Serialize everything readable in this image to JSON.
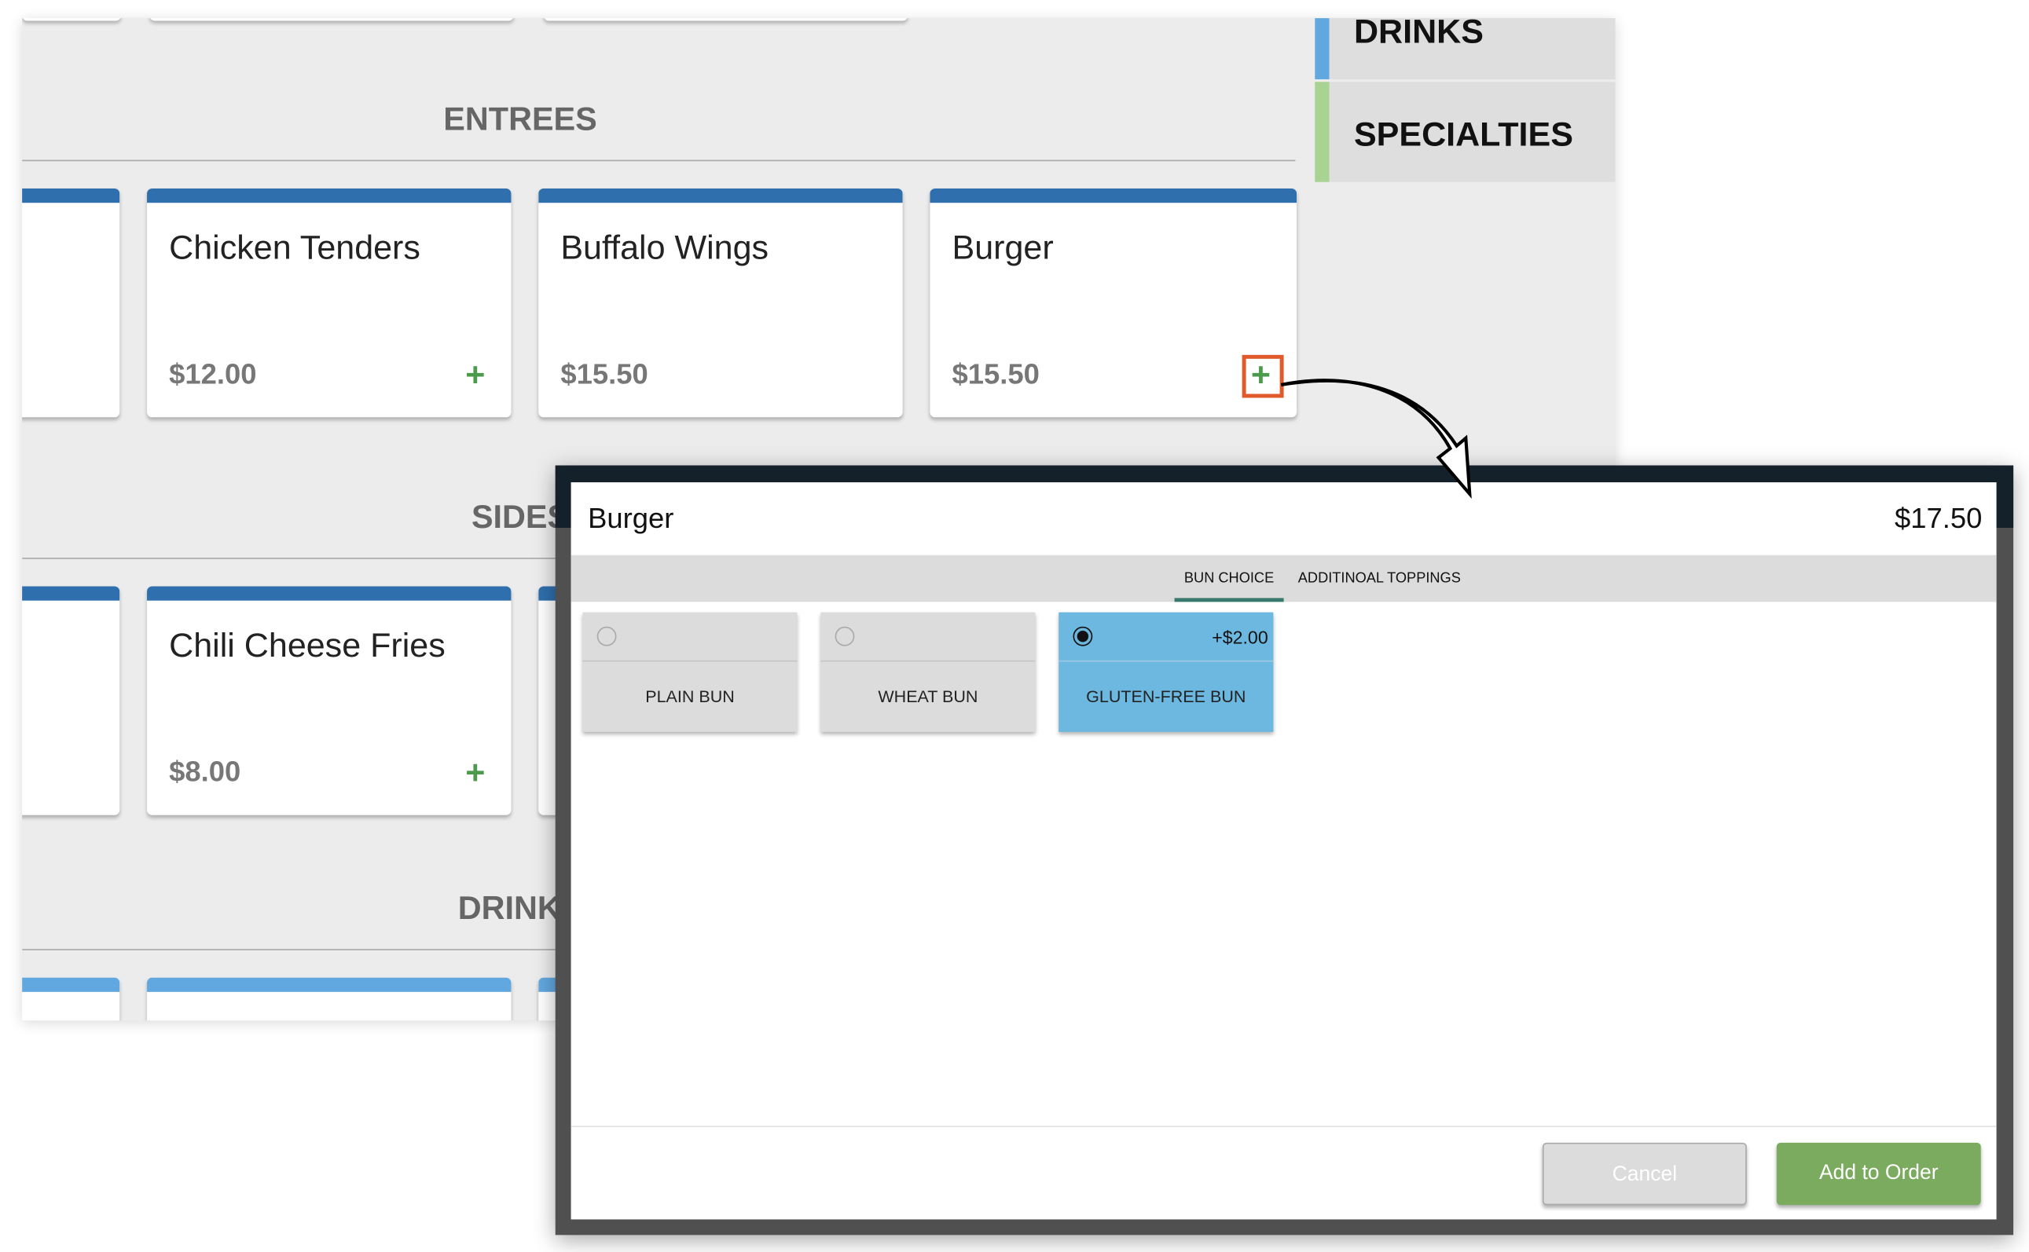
{
  "sidebar": {
    "items": [
      {
        "label": "DRINKS",
        "color": "#62a8e0"
      },
      {
        "label": "SPECIALTIES",
        "color": "#a8d392"
      }
    ]
  },
  "sections": [
    {
      "title": "ENTREES",
      "items": [
        {
          "name": "Chicken Tenders",
          "price": "$12.00"
        },
        {
          "name": "Buffalo Wings",
          "price": "$15.50"
        },
        {
          "name": "Burger",
          "price": "$15.50"
        }
      ]
    },
    {
      "title": "SIDES",
      "items": [
        {
          "name": "Chili Cheese Fries",
          "price": "$8.00"
        }
      ]
    },
    {
      "title": "DRINKS",
      "items": []
    }
  ],
  "icons": {
    "add": "plus-icon",
    "highlight": "#e05a2b"
  },
  "modal": {
    "title": "Burger",
    "total": "$17.50",
    "tabs": [
      {
        "label": "BUN CHOICE",
        "active": true
      },
      {
        "label": "ADDITINOAL TOPPINGS",
        "active": false
      }
    ],
    "options": [
      {
        "label": "PLAIN BUN",
        "selected": false
      },
      {
        "label": "WHEAT BUN",
        "selected": false
      },
      {
        "label": "GLUTEN-FREE BUN",
        "extra": "+$2.00",
        "selected": true
      }
    ],
    "cancel_label": "Cancel",
    "add_label": "Add to Order"
  }
}
